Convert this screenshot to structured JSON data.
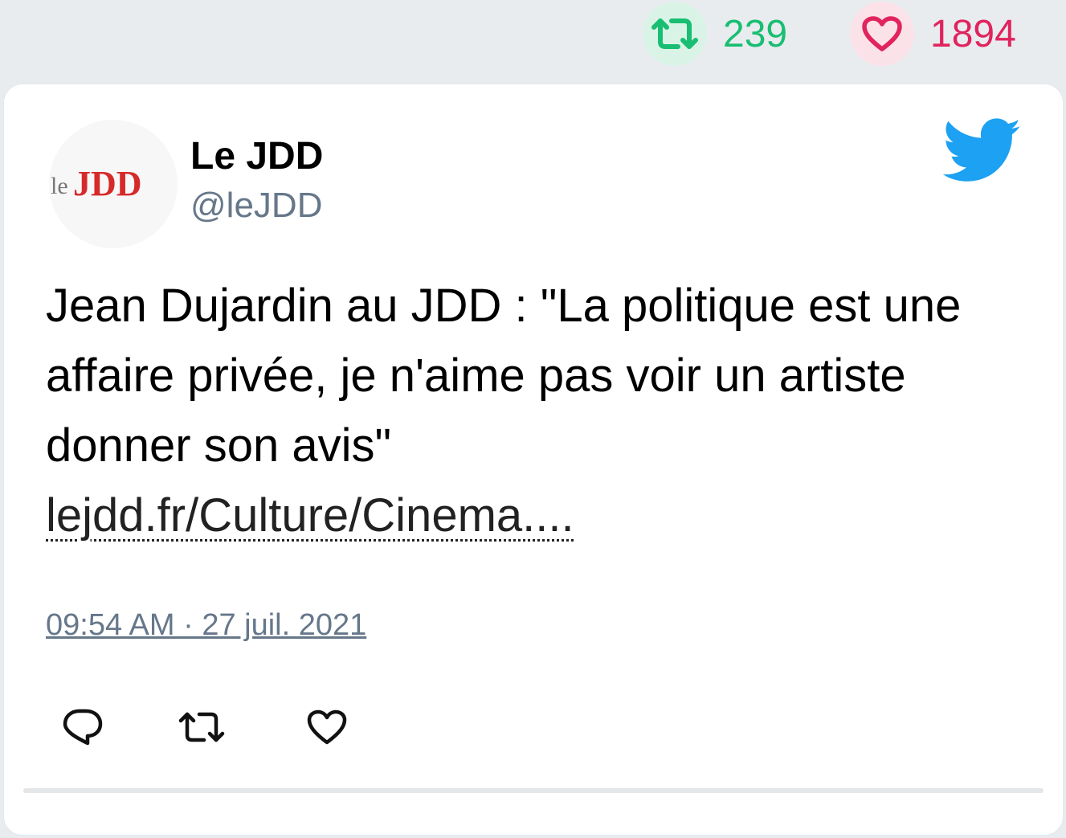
{
  "stats": {
    "retweet_count": "239",
    "like_count": "1894",
    "retweet_color": "#19be72",
    "like_color": "#e0245e"
  },
  "tweet": {
    "author_name": "Le JDD",
    "author_handle": "@leJDD",
    "avatar_logo_text": "leJDD",
    "text": "Jean Dujardin au JDD : \"La politique est une affaire privée, je n'aime pas voir un artiste donner son avis\"",
    "link_text": "lejdd.fr/Culture/Cinema....",
    "timestamp": "09:54 AM · 27 juil. 2021",
    "brand_icon": "twitter-bird-icon"
  },
  "actions": [
    {
      "icon": "reply-icon"
    },
    {
      "icon": "retweet-icon"
    },
    {
      "icon": "like-icon"
    }
  ]
}
